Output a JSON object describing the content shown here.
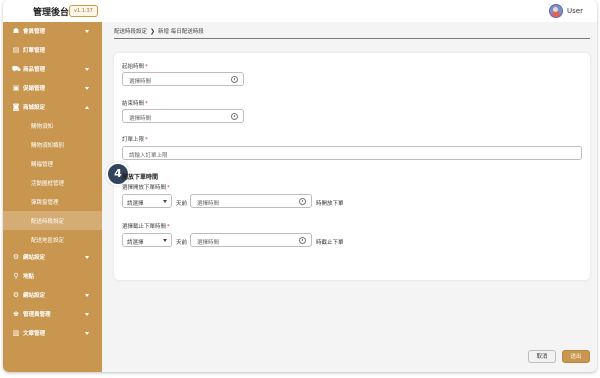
{
  "header": {
    "brand": "管理後台",
    "version": "v1.1.37",
    "user_name": "User"
  },
  "sidebar": {
    "items": [
      {
        "label": "會員管理",
        "icon": "member-icon",
        "glyph": "☗",
        "chevron": "down"
      },
      {
        "label": "訂單管理",
        "icon": "order-icon",
        "glyph": "▤",
        "chevron": ""
      },
      {
        "label": "商品管理",
        "icon": "cart-icon",
        "glyph": "⛟",
        "chevron": "down"
      },
      {
        "label": "促銷管理",
        "icon": "promo-icon",
        "glyph": "▣",
        "chevron": "down"
      },
      {
        "label": "商城設定",
        "icon": "store-icon",
        "glyph": "◙",
        "chevron": "up"
      }
    ],
    "sub_items": [
      {
        "label": "購物須知",
        "active": false
      },
      {
        "label": "購物須知類別",
        "active": false
      },
      {
        "label": "購福管理",
        "active": false
      },
      {
        "label": "活動圖框管理",
        "active": false
      },
      {
        "label": "彈跳窗管理",
        "active": false
      },
      {
        "label": "配送時段設定",
        "active": true
      },
      {
        "label": "配送地區設定",
        "active": false
      }
    ],
    "bottom_items": [
      {
        "label": "網站設定",
        "icon": "gear-icon",
        "glyph": "⚙",
        "chevron": "down"
      },
      {
        "label": "地點",
        "icon": "location-pin-icon",
        "glyph": "⚲",
        "chevron": ""
      },
      {
        "label": "網站設定",
        "icon": "gear-icon",
        "glyph": "⚙",
        "chevron": "down"
      },
      {
        "label": "管理員管理",
        "icon": "admins-icon",
        "glyph": "♚",
        "chevron": "down"
      },
      {
        "label": "文章管理",
        "icon": "article-icon",
        "glyph": "▥",
        "chevron": "down"
      }
    ]
  },
  "breadcrumb": {
    "parent": "配送時段設定",
    "separator": "❯",
    "current": "新增 每日配送時段"
  },
  "form": {
    "start_time": {
      "label": "起始時間",
      "placeholder": "選擇時間"
    },
    "end_time": {
      "label": "結束時間",
      "placeholder": "選擇時間"
    },
    "order_limit": {
      "label": "訂單上限",
      "placeholder": "請輸入訂單上限"
    },
    "open_section": {
      "title": "開放下單時間",
      "open_label": "選擇開放下單時間",
      "close_label": "選擇截止下單時間",
      "select_placeholder": "請選擇",
      "days_before": "天前",
      "time_placeholder": "選擇時間",
      "open_suffix": "時開放下單",
      "close_suffix": "時截止下單"
    }
  },
  "step_badge": "4",
  "footer": {
    "cancel": "取消",
    "submit": "送出"
  },
  "colors": {
    "sidebar": "#c8964f",
    "badge": "#32435d",
    "required": "#c0392b"
  }
}
